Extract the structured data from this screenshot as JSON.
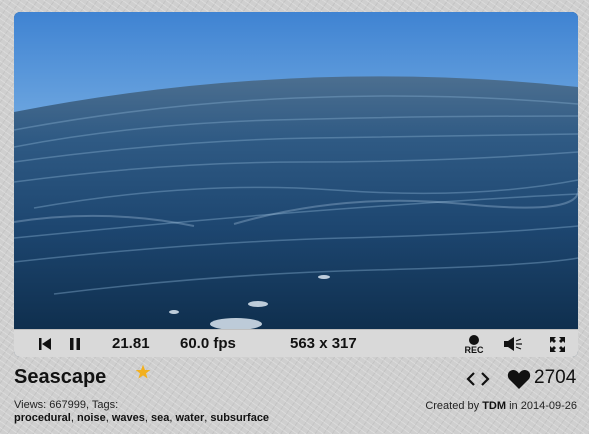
{
  "controls": {
    "time": "21.81",
    "fps": "60.0 fps",
    "resolution": "563 x 317",
    "rec_label": "REC"
  },
  "shader": {
    "title": "Seascape",
    "views_label": "Views: 667999, Tags:",
    "tags": [
      "procedural",
      "noise",
      "waves",
      "sea",
      "water",
      "subsurface"
    ],
    "likes": "2704",
    "created_by_prefix": "Created by",
    "author": "TDM",
    "created_in": "in",
    "date": "2014-09-26"
  },
  "icons": {
    "rewind": "skip-back-icon",
    "pause": "pause-icon",
    "record": "record-icon",
    "volume": "speaker-icon",
    "fullscreen": "fullscreen-icon",
    "favorite": "star-icon",
    "embed": "code-brackets-icon",
    "like": "heart-icon"
  },
  "colors": {
    "star": "#f2b01e",
    "control_bar": "#d9d9d9",
    "sky_top": "#4d8dd6",
    "sea_deep": "#16395c"
  }
}
